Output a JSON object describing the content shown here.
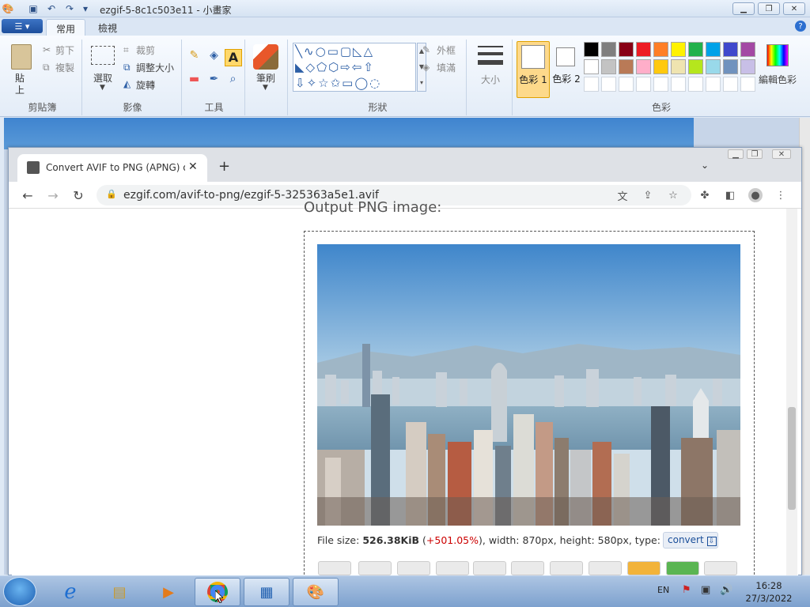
{
  "paint": {
    "title": "ezgif-5-8c1c503e11 - 小畫家",
    "tabs": [
      "常用",
      "檢視"
    ],
    "clipboard": {
      "paste": "貼上",
      "cut": "剪下",
      "copy": "複製",
      "label": "剪貼簿"
    },
    "image": {
      "select": "選取",
      "crop": "裁剪",
      "resize": "調整大小",
      "rotate": "旋轉",
      "label": "影像"
    },
    "tools": {
      "label": "工具"
    },
    "brushes": {
      "label": "筆刷"
    },
    "shapes": {
      "outline": "外框",
      "fill": "填滿",
      "label": "形狀"
    },
    "size": {
      "label": "大小"
    },
    "colors": {
      "color1": "色彩 1",
      "color2": "色彩 2",
      "edit": "編輯色彩",
      "label": "色彩",
      "row1": [
        "#000000",
        "#7f7f7f",
        "#880015",
        "#ed1c24",
        "#ff7f27",
        "#fff200",
        "#22b14c",
        "#00a2e8",
        "#3f48cc",
        "#a349a4"
      ],
      "row2": [
        "#ffffff",
        "#c3c3c3",
        "#b97a57",
        "#ffaec9",
        "#ffc90e",
        "#efe4b0",
        "#b5e61d",
        "#99d9ea",
        "#7092be",
        "#c8bfe7"
      ]
    }
  },
  "browser": {
    "tab_title": "Convert AVIF to PNG (APNG) o",
    "url": "ezgif.com/avif-to-png/ezgif-5-325363a5e1.avif",
    "heading_cut": "Output PNG image:",
    "file_info": {
      "prefix": "File size: ",
      "size": "526.38KiB",
      "change_open": " (",
      "change": "+501.05%",
      "change_close": ")",
      "rest": ", width: 870px, height: 580px, type: png"
    },
    "convert_label": "convert"
  },
  "taskbar": {
    "lang": "EN",
    "time": "16:28",
    "date": "27/3/2022"
  }
}
